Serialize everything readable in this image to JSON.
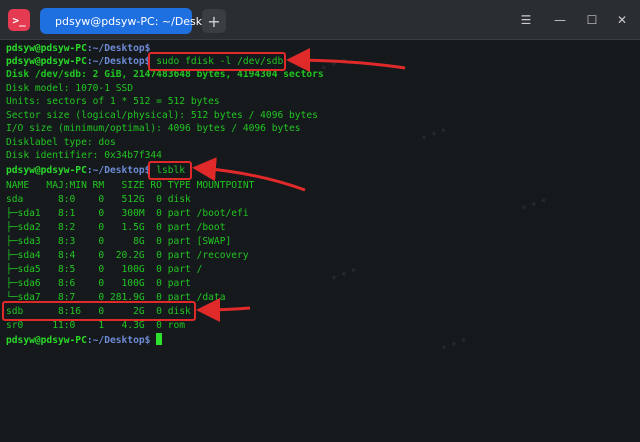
{
  "window": {
    "tab_title": "pdsyw@pdsyw-PC: ~/Desktop",
    "new_tab_label": "+",
    "app_icon_glyph": ">_"
  },
  "terminal": {
    "prompt_user": "pdsyw@pdsyw-PC",
    "prompt_path": ":~/Desktop$",
    "commands": {
      "fdisk": "sudo fdisk -l /dev/sdb",
      "lsblk": "lsblk"
    },
    "fdisk_output": [
      "Disk /dev/sdb: 2 GiB, 2147483648 bytes, 4194304 sectors",
      "Disk model: 1070-1 SSD",
      "Units: sectors of 1 * 512 = 512 bytes",
      "Sector size (logical/physical): 512 bytes / 4096 bytes",
      "I/O size (minimum/optimal): 4096 bytes / 4096 bytes",
      "Disklabel type: dos",
      "Disk identifier: 0x34b7f344"
    ],
    "lsblk_output": [
      "NAME   MAJ:MIN RM   SIZE RO TYPE MOUNTPOINT",
      "sda      8:0    0   512G  0 disk",
      "├─sda1   8:1    0   300M  0 part /boot/efi",
      "├─sda2   8:2    0   1.5G  0 part /boot",
      "├─sda3   8:3    0     8G  0 part [SWAP]",
      "├─sda4   8:4    0  20.2G  0 part /recovery",
      "├─sda5   8:5    0   100G  0 part /",
      "├─sda6   8:6    0   100G  0 part",
      "└─sda7   8:7    0 281.9G  0 part /data",
      "sdb      8:16   0     2G  0 disk",
      "sr0     11:0    1   4.3G  0 rom"
    ]
  },
  "colors": {
    "highlight_box": "#e02a2a",
    "terminal_text": "#21c521",
    "tab_active": "#1e6fe0"
  }
}
